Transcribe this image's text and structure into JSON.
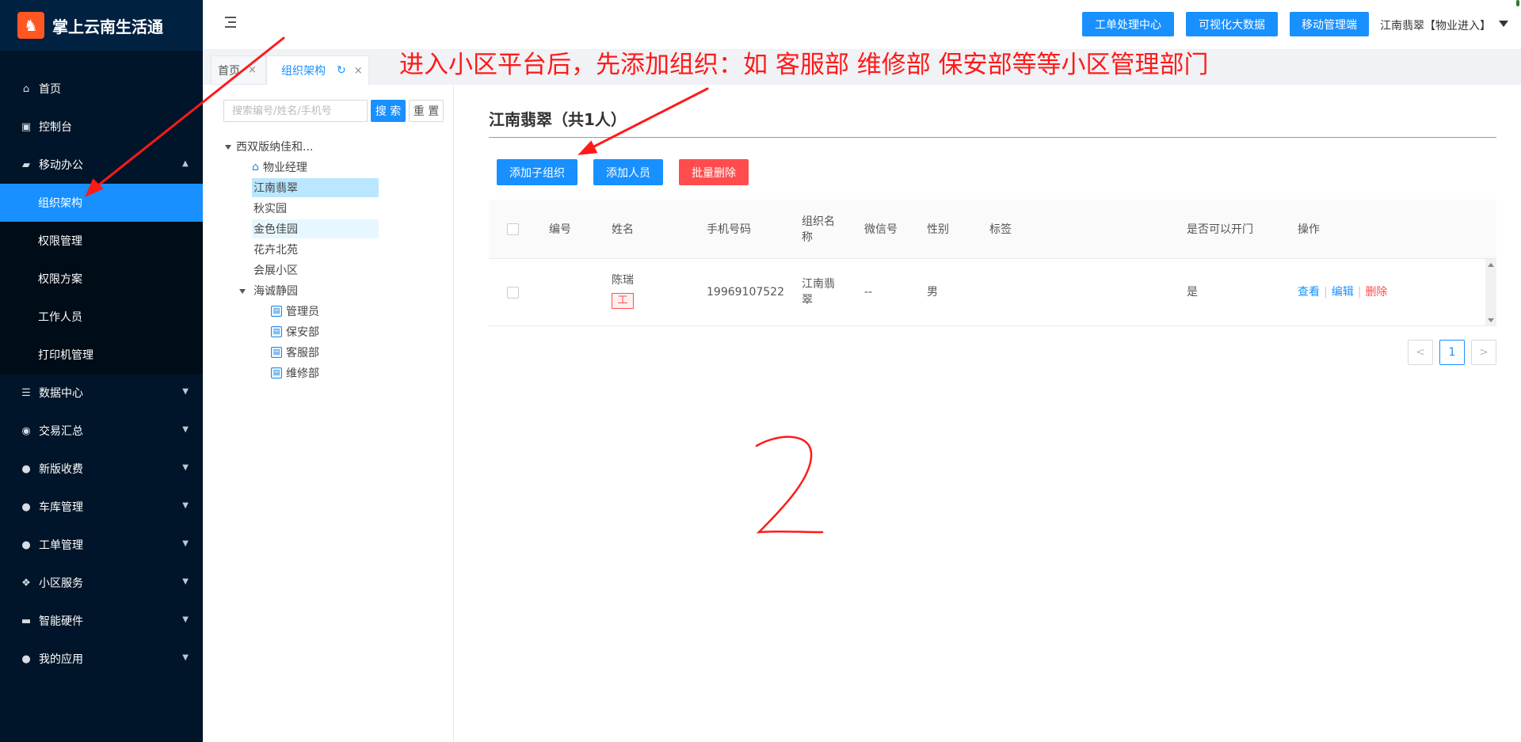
{
  "app": {
    "title": "掌上云南生活通",
    "logo_glyph": "♞"
  },
  "sidebar": {
    "items": [
      {
        "label": "首页",
        "icon": "home-icon",
        "glyph": "⌂"
      },
      {
        "label": "控制台",
        "icon": "monitor-icon",
        "glyph": "▣"
      },
      {
        "label": "移动办公",
        "icon": "briefcase-icon",
        "glyph": "▰",
        "open": true,
        "children": [
          "组织架构",
          "权限管理",
          "权限方案",
          "工作人员",
          "打印机管理"
        ],
        "active_child": "组织架构"
      },
      {
        "label": "数据中心",
        "icon": "database-icon",
        "glyph": "☰"
      },
      {
        "label": "交易汇总",
        "icon": "moneybag-icon",
        "glyph": "◉"
      },
      {
        "label": "新版收费",
        "icon": "chat-icon",
        "glyph": "●"
      },
      {
        "label": "车库管理",
        "icon": "chat-icon",
        "glyph": "●"
      },
      {
        "label": "工单管理",
        "icon": "chat-icon",
        "glyph": "●"
      },
      {
        "label": "小区服务",
        "icon": "handshake-icon",
        "glyph": "❖"
      },
      {
        "label": "智能硬件",
        "icon": "hardware-icon",
        "glyph": "▬"
      },
      {
        "label": "我的应用",
        "icon": "user-icon",
        "glyph": "●"
      }
    ]
  },
  "header": {
    "buttons": [
      "工单处理中心",
      "可视化大数据",
      "移动管理端"
    ],
    "user": "江南翡翠【物业进入】"
  },
  "tabs": [
    {
      "label": "首页",
      "close": "×"
    },
    {
      "label": "组织架构",
      "refresh": "↻",
      "close": "×"
    }
  ],
  "annotation": "进入小区平台后，先添加组织：如  客服部  维修部  保安部等等小区管理部门",
  "tree_panel": {
    "search_placeholder": "搜索编号/姓名/手机号",
    "search_label": "搜 索",
    "reset_label": "重 置",
    "nodes": [
      {
        "label": "西双版纳佳和...",
        "expanded": true
      },
      {
        "label": "物业经理",
        "icon": "house-icon"
      },
      {
        "label": "江南翡翠",
        "selected": true
      },
      {
        "label": "秋实园"
      },
      {
        "label": "金色佳园",
        "hover": true
      },
      {
        "label": "花卉北苑"
      },
      {
        "label": "会展小区"
      },
      {
        "label": "海诚静园",
        "expanded": true
      },
      {
        "label": "管理员",
        "icon": "department-icon"
      },
      {
        "label": "保安部",
        "icon": "department-icon"
      },
      {
        "label": "客服部",
        "icon": "department-icon"
      },
      {
        "label": "维修部",
        "icon": "department-icon"
      }
    ]
  },
  "main": {
    "title": "江南翡翠（共1人）",
    "actions": {
      "add_sub_org": "添加子组织",
      "add_person": "添加人员",
      "batch_delete": "批量删除"
    },
    "table": {
      "headers": [
        "编号",
        "姓名",
        "手机号码",
        "组织名\n称",
        "微信号",
        "性别",
        "标签",
        "是否可以开门",
        "操作"
      ],
      "rows": [
        {
          "id": "",
          "name": "陈瑞",
          "tag": "工",
          "phone": "19969107522",
          "org": "江南翡\n翠",
          "wechat": "--",
          "gender": "男",
          "labels": "",
          "can_open_door": "是",
          "ops": [
            "查看",
            "编辑",
            "删除"
          ]
        }
      ]
    },
    "pagination": {
      "prev": "<",
      "current": "1",
      "next": ">"
    }
  },
  "colors": {
    "sidebar_bg": "#001529",
    "accent": "#1890ff",
    "danger": "#ff4d4f",
    "annotation": "#ff1a1a"
  }
}
